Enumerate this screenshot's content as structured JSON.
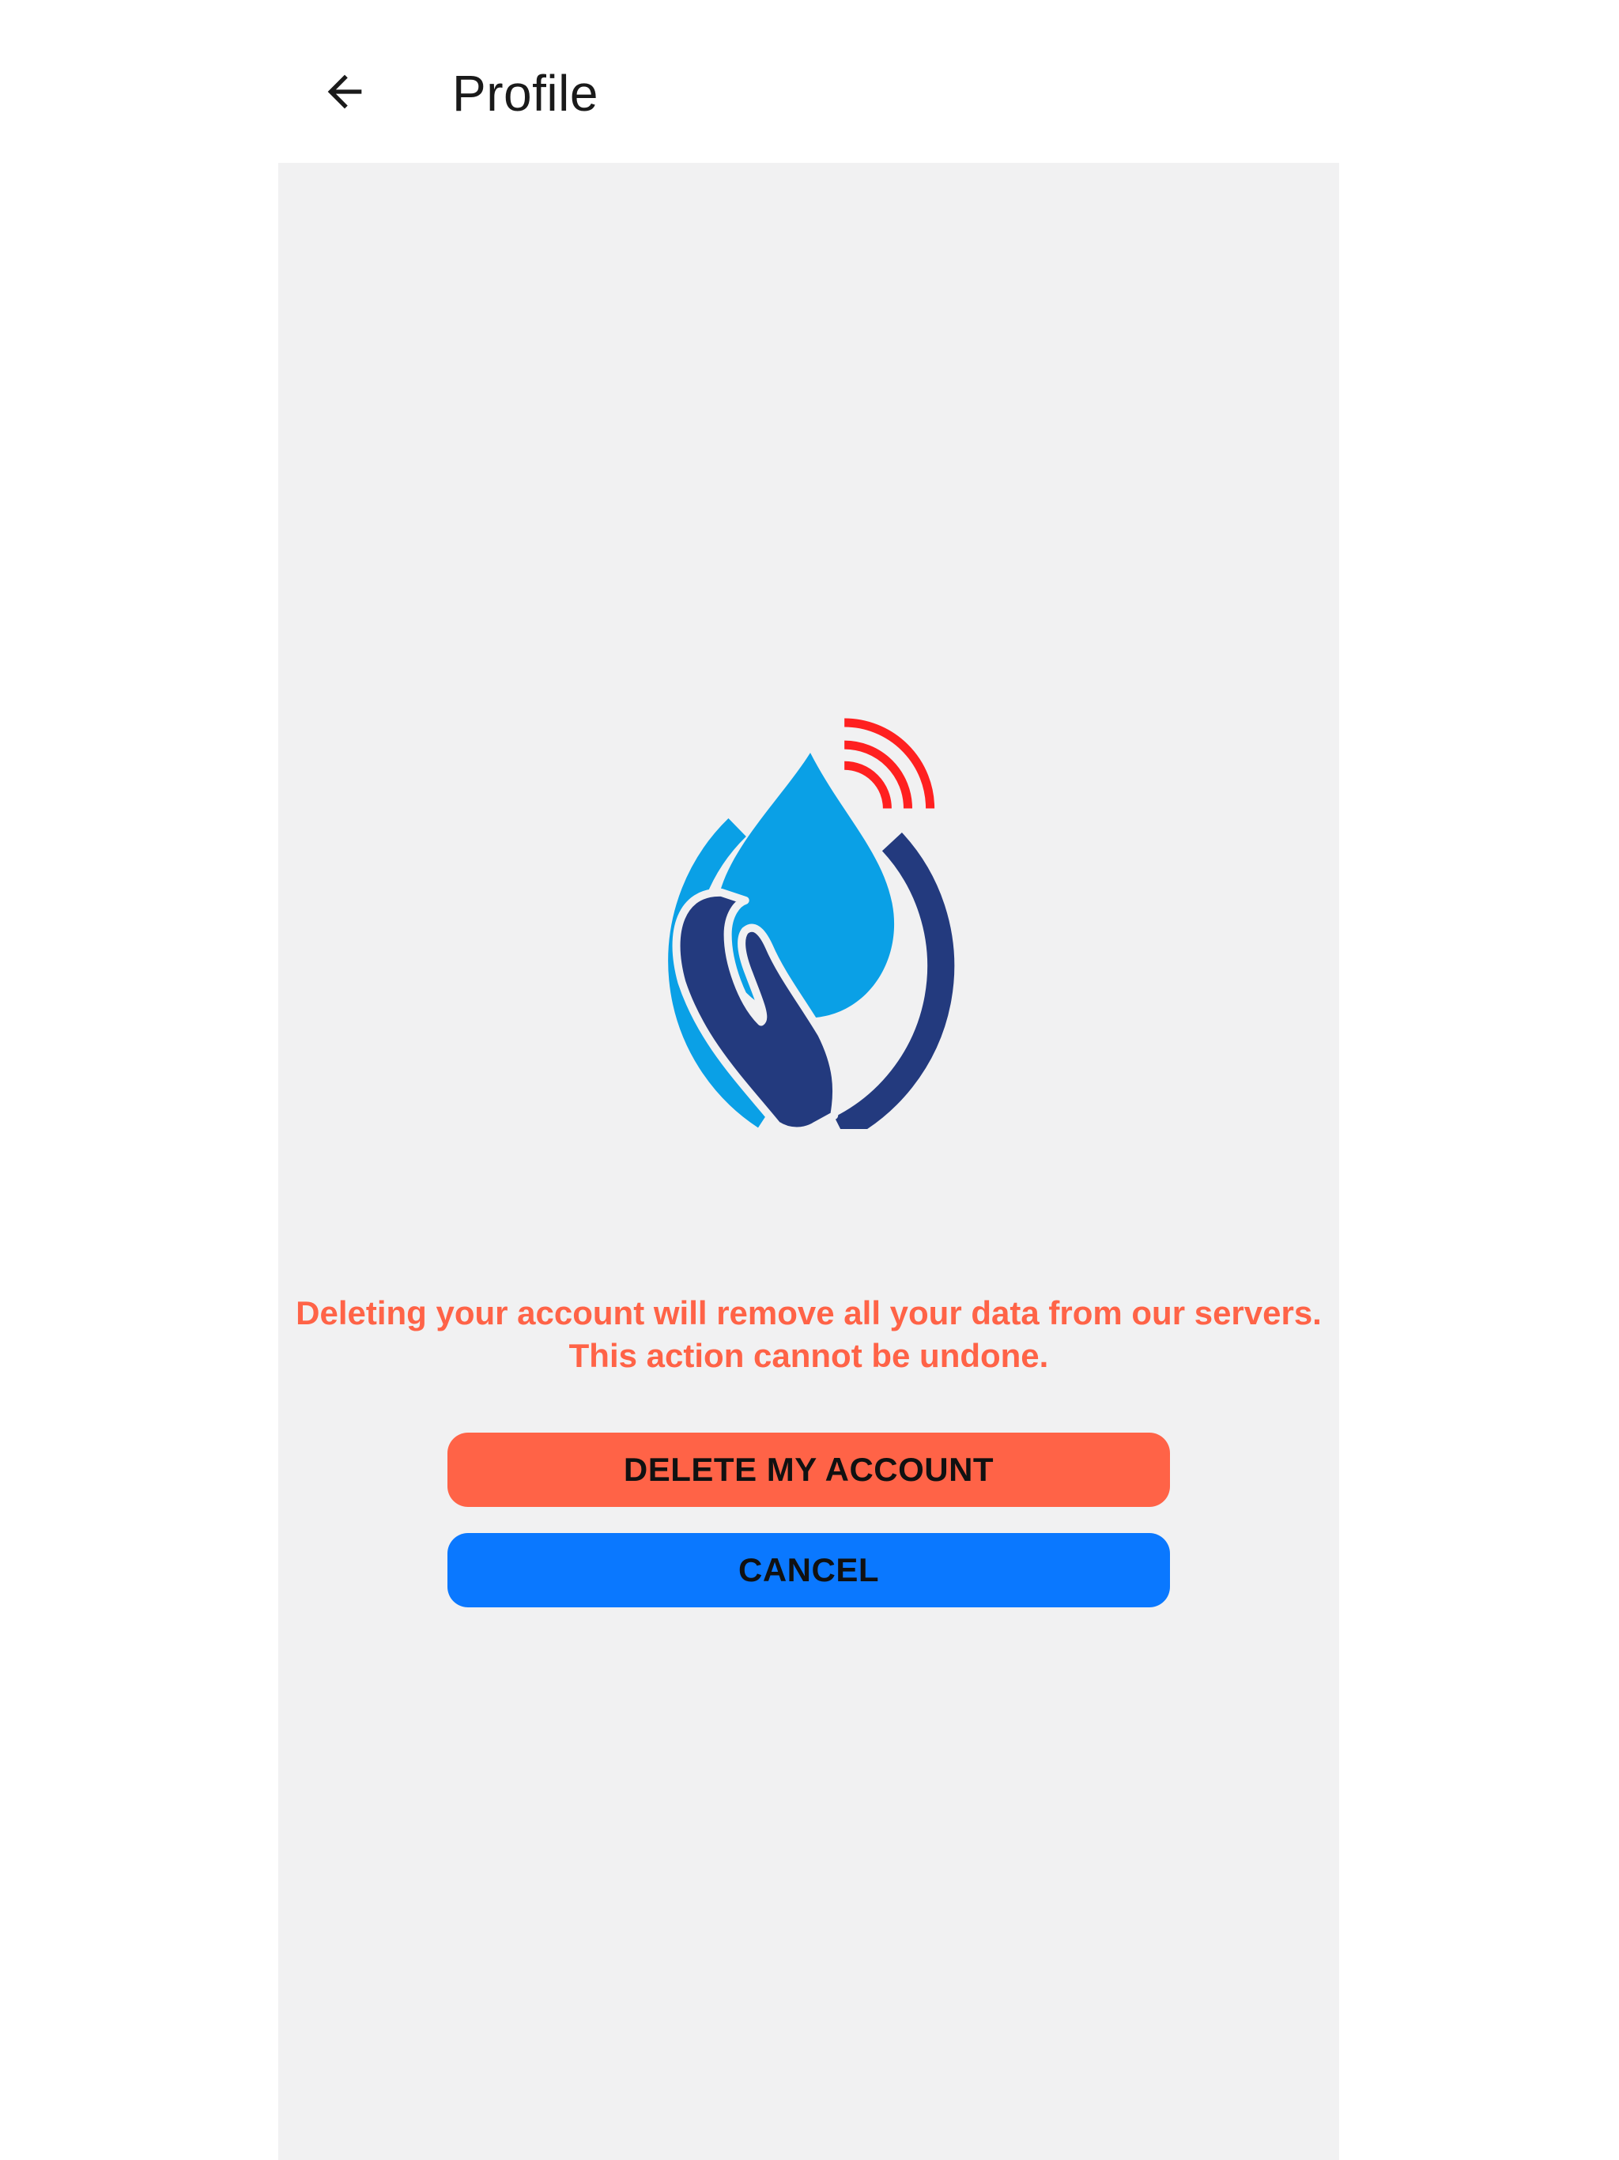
{
  "header": {
    "title": "Profile",
    "back_icon": "arrow-left-icon"
  },
  "main": {
    "logo_icon": "water-drop-hand-logo",
    "warning": "Deleting your account will remove all your data from our servers. This action cannot be undone.",
    "delete_button_label": "DELETE MY ACCOUNT",
    "cancel_button_label": "CANCEL"
  },
  "colors": {
    "panel_background": "#f1f1f2",
    "warning_text": "#ff6347",
    "delete_button": "#ff6347",
    "cancel_button": "#0a78ff",
    "logo_light_blue": "#0aa0e6",
    "logo_dark_blue": "#233a7e",
    "logo_signal_red": "#ff2020"
  }
}
